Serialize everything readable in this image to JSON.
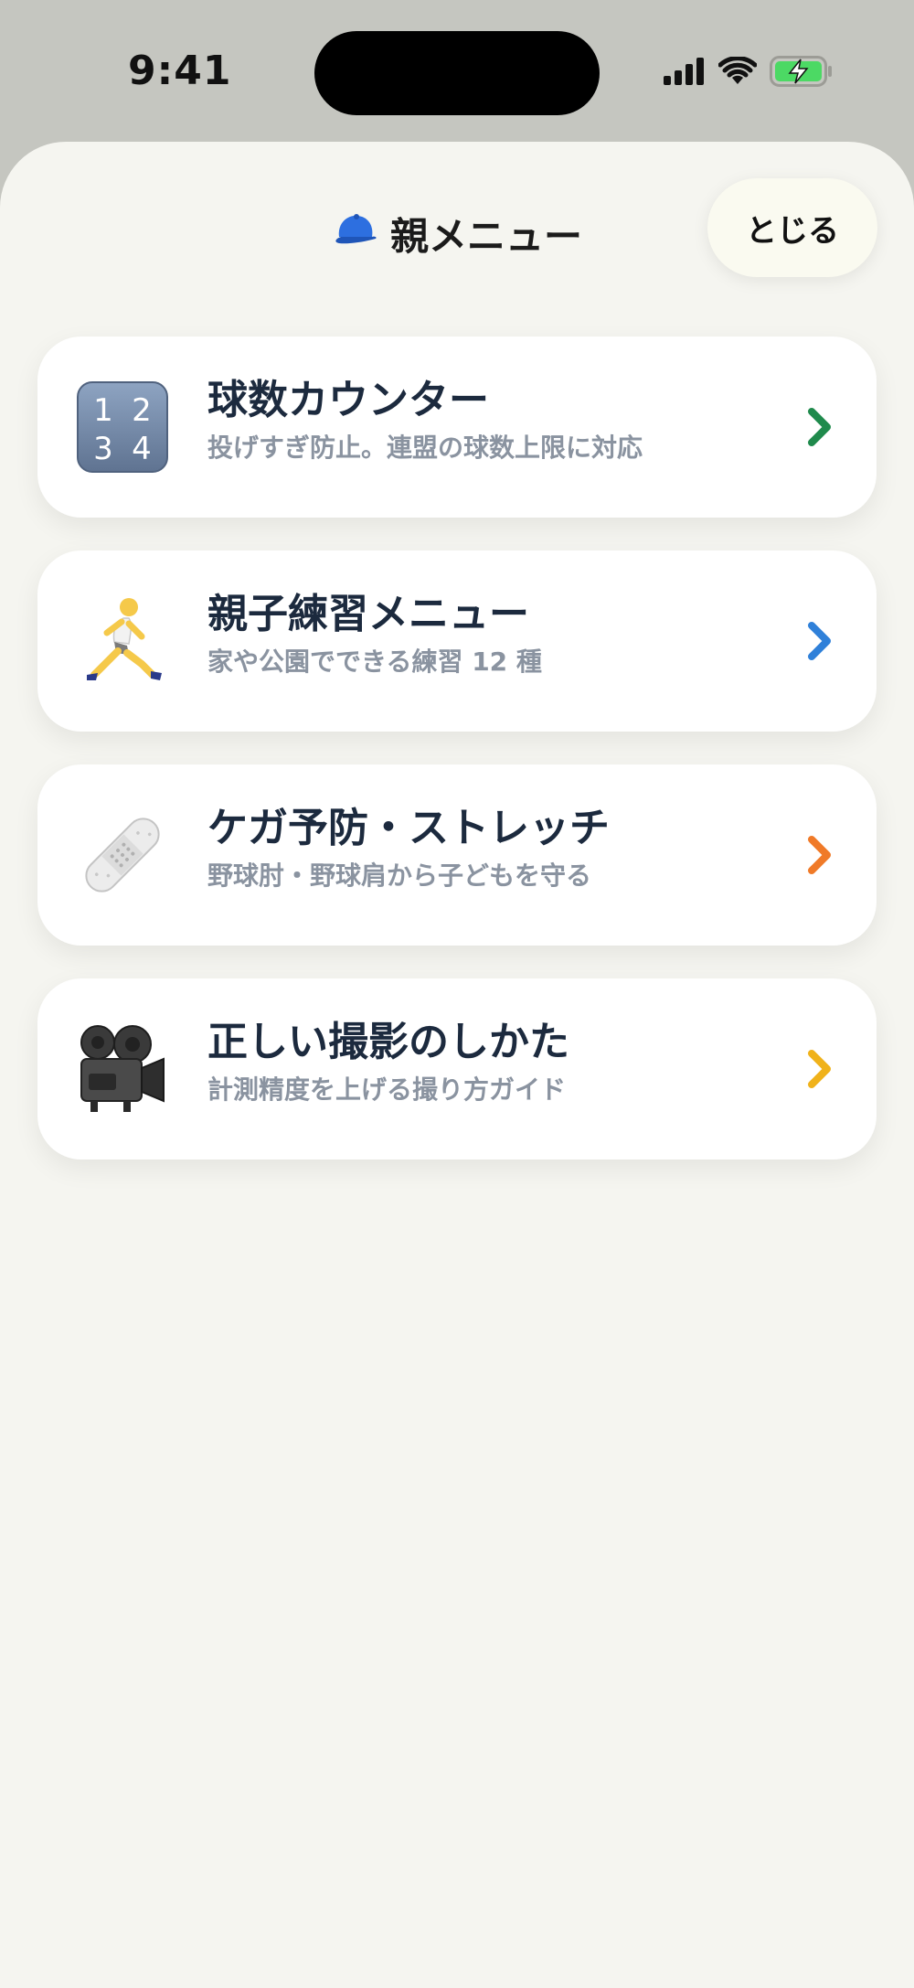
{
  "status_bar": {
    "time": "9:41"
  },
  "sheet": {
    "title_icon": "cap-icon",
    "title": "親メニュー",
    "close_label": "とじる"
  },
  "menu_items": [
    {
      "icon": "numbers-1234-icon",
      "title": "球数カウンター",
      "subtitle": "投げすぎ防止。連盟の球数上限に対応",
      "chevron_color": "#1f8a4c"
    },
    {
      "icon": "runner-icon",
      "title": "親子練習メニュー",
      "subtitle": "家や公園でできる練習 12 種",
      "chevron_color": "#2f80d9"
    },
    {
      "icon": "bandage-icon",
      "title": "ケガ予防・ストレッチ",
      "subtitle": "野球肘・野球肩から子どもを守る",
      "chevron_color": "#f07a28"
    },
    {
      "icon": "movie-camera-icon",
      "title": "正しい撮影のしかた",
      "subtitle": "計測精度を上げる撮り方ガイド",
      "chevron_color": "#f0b21a"
    }
  ],
  "keypad_digits": {
    "d1": "1",
    "d2": "2",
    "d3": "3",
    "d4": "4"
  }
}
